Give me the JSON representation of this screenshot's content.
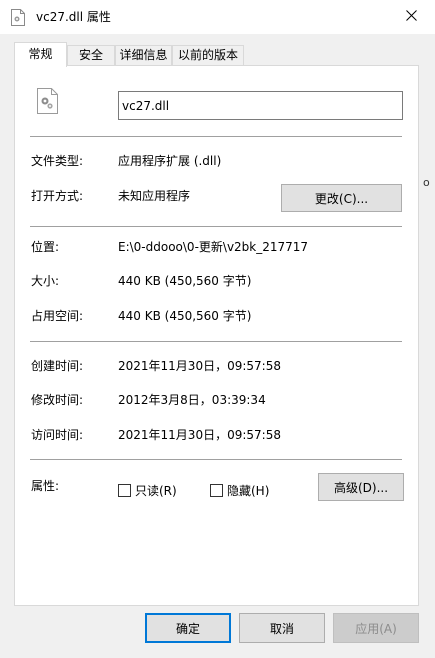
{
  "window": {
    "title": "vc27.dll 属性",
    "close_icon": "close-icon"
  },
  "tabs": [
    {
      "label": "常规",
      "active": true
    },
    {
      "label": "安全",
      "active": false
    },
    {
      "label": "详细信息",
      "active": false
    },
    {
      "label": "以前的版本",
      "active": false
    }
  ],
  "general": {
    "file_name": "vc27.dll",
    "file_type_label": "文件类型:",
    "file_type_value": "应用程序扩展 (.dll)",
    "opens_with_label": "打开方式:",
    "opens_with_value": "未知应用程序",
    "change_button": "更改(C)...",
    "location_label": "位置:",
    "location_value": "E:\\0-ddooo\\0-更新\\v2bk_217717",
    "size_label": "大小:",
    "size_value": "440 KB (450,560 字节)",
    "size_on_disk_label": "占用空间:",
    "size_on_disk_value": "440 KB (450,560 字节)",
    "created_label": "创建时间:",
    "created_value": "2021年11月30日，09:57:58",
    "modified_label": "修改时间:",
    "modified_value": "2012年3月8日，03:39:34",
    "accessed_label": "访问时间:",
    "accessed_value": "2021年11月30日，09:57:58",
    "attributes_label": "属性:",
    "readonly_label": "只读(R)",
    "readonly_checked": false,
    "hidden_label": "隐藏(H)",
    "hidden_checked": false,
    "advanced_button": "高级(D)..."
  },
  "footer": {
    "ok": "确定",
    "cancel": "取消",
    "apply": "应用(A)"
  },
  "background_fragment": "o",
  "colors": {
    "accent": "#0078d7",
    "window_bg": "#f0f0f0",
    "panel_bg": "#ffffff"
  }
}
